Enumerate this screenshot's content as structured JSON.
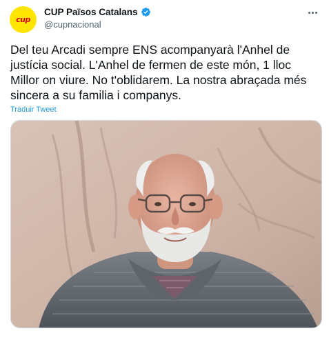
{
  "account": {
    "display_name": "CUP Països Catalans",
    "handle": "@cupnacional",
    "avatar_text": "cup",
    "verified": true
  },
  "tweet": {
    "text": "Del teu Arcadi sempre ENS acompanyarà l'Anhel de justícia social. L'Anhel de fermen de este món, 1 lloc Millor on viure. No t'oblidarem. La nostra abraçada més sincera a su familia i companys.",
    "translate_label": "Traduir Tweet",
    "meta_partial": ""
  },
  "media": {
    "description_icon": "photo-elderly-man"
  },
  "colors": {
    "accent": "#1d9bf0",
    "avatar_bg": "#ffe500",
    "avatar_text": "#d4001a"
  }
}
